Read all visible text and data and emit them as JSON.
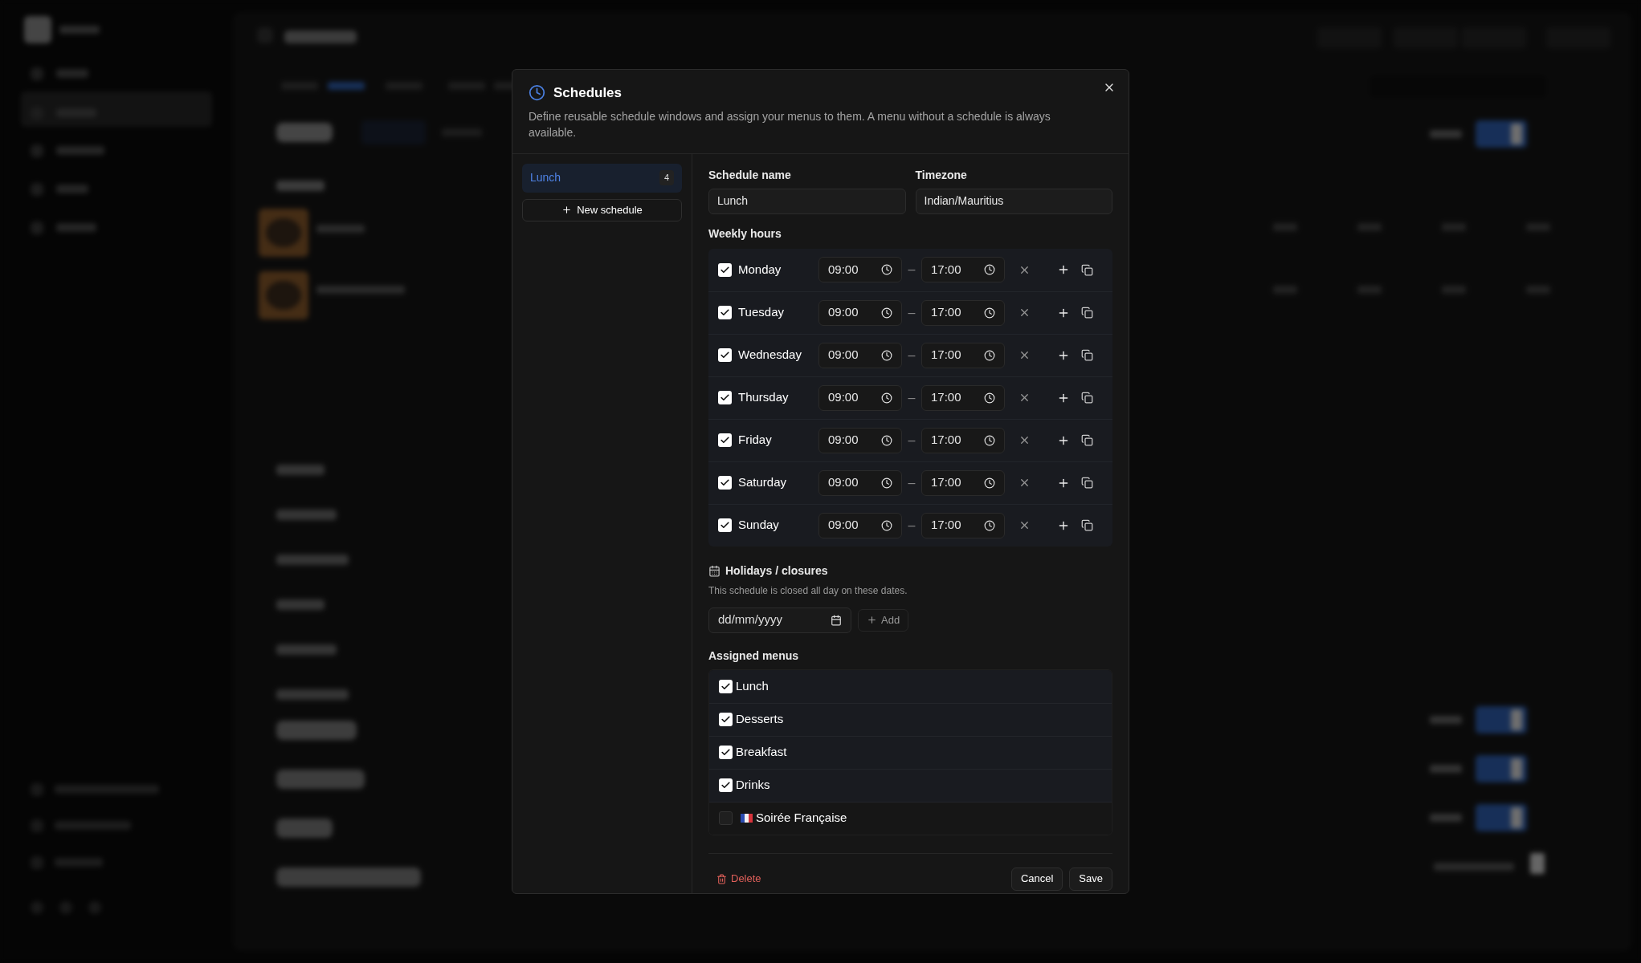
{
  "dialog": {
    "title": "Schedules",
    "description": "Define reusable schedule windows and assign your menus to them. A menu without a schedule is always available.",
    "schedules": [
      {
        "name": "Lunch",
        "count": "4",
        "selected": true
      }
    ],
    "new_schedule": "New schedule",
    "name_label": "Schedule name",
    "name_value": "Lunch",
    "timezone_label": "Timezone",
    "timezone_value": "Indian/Mauritius",
    "weekly_label": "Weekly hours",
    "days": [
      {
        "day": "Monday",
        "checked": true,
        "from": "09:00",
        "to": "17:00"
      },
      {
        "day": "Tuesday",
        "checked": true,
        "from": "09:00",
        "to": "17:00"
      },
      {
        "day": "Wednesday",
        "checked": true,
        "from": "09:00",
        "to": "17:00"
      },
      {
        "day": "Thursday",
        "checked": true,
        "from": "09:00",
        "to": "17:00"
      },
      {
        "day": "Friday",
        "checked": true,
        "from": "09:00",
        "to": "17:00"
      },
      {
        "day": "Saturday",
        "checked": true,
        "from": "09:00",
        "to": "17:00"
      },
      {
        "day": "Sunday",
        "checked": true,
        "from": "09:00",
        "to": "17:00"
      }
    ],
    "dash": "–",
    "holidays_title": "Holidays / closures",
    "holidays_note": "This schedule is closed all day on these dates.",
    "date_placeholder": "dd/mm/yyyy",
    "add": "Add",
    "assigned_label": "Assigned menus",
    "assigned": [
      {
        "name": "Lunch",
        "checked": true,
        "flag": false
      },
      {
        "name": "Desserts",
        "checked": true,
        "flag": false
      },
      {
        "name": "Breakfast",
        "checked": true,
        "flag": false
      },
      {
        "name": "Drinks",
        "checked": true,
        "flag": false
      },
      {
        "name": "Soirée Française",
        "checked": false,
        "flag": true
      }
    ],
    "delete": "Delete",
    "cancel": "Cancel",
    "save": "Save"
  }
}
